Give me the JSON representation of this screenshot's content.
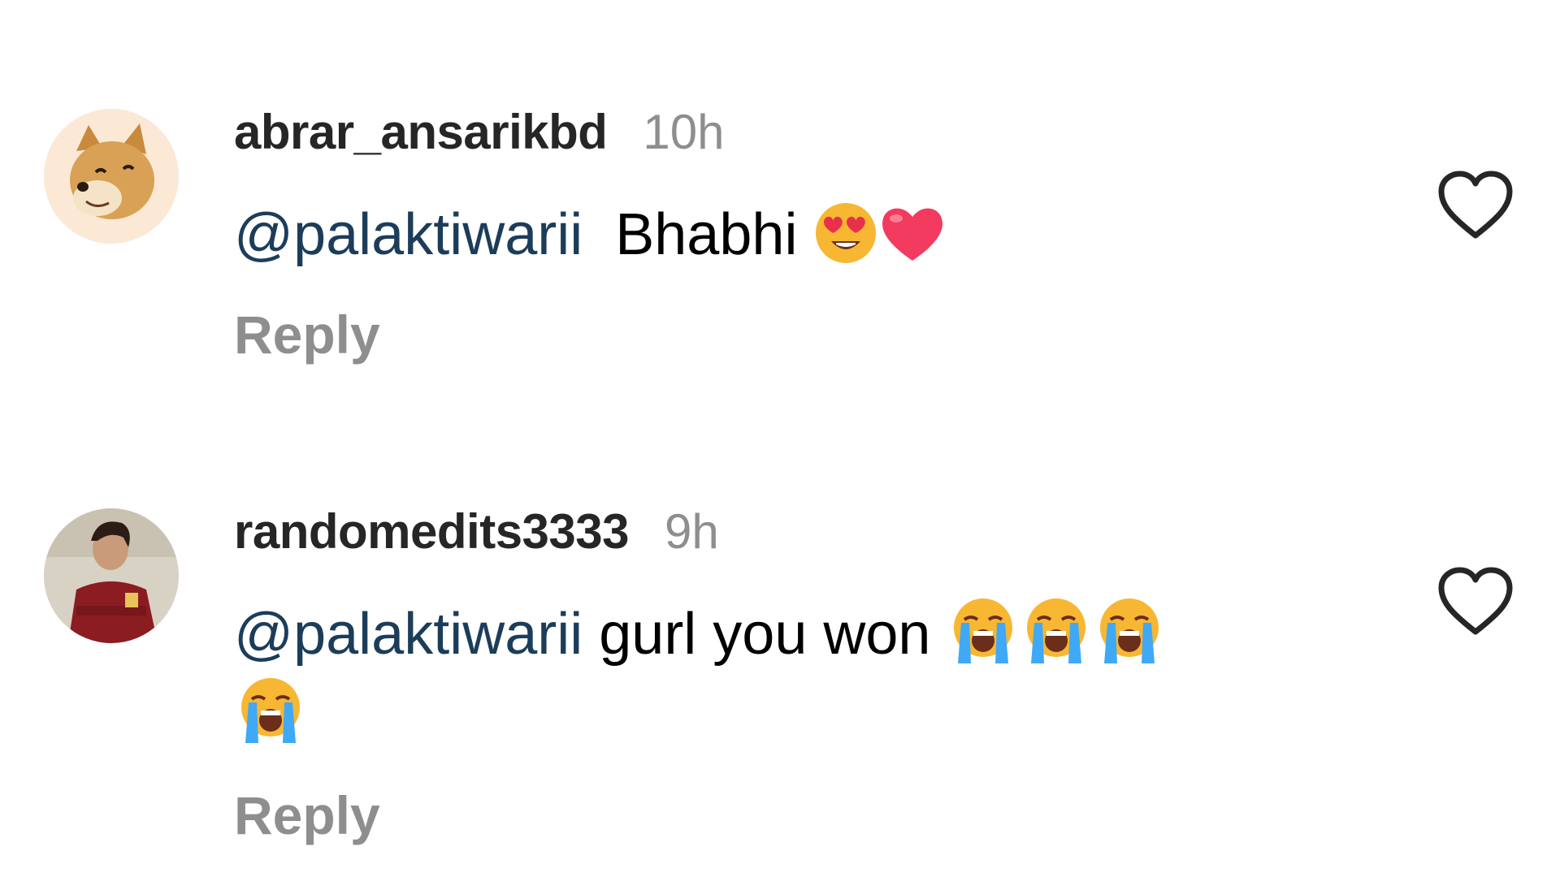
{
  "comments": [
    {
      "username": "abrar_ansarikbd",
      "time": "10h",
      "mention": "@palaktiwarii",
      "text": "  Bhabhi ",
      "emojis": [
        "heart-eyes",
        "red-heart"
      ],
      "reply_label": "Reply",
      "avatar": "doge-avatar"
    },
    {
      "username": "randomedits3333",
      "time": "9h",
      "mention": "@palaktiwarii",
      "text": " gurl you won ",
      "emojis": [
        "loudly-crying",
        "loudly-crying",
        "loudly-crying",
        "loudly-crying"
      ],
      "reply_label": "Reply",
      "avatar": "person-avatar"
    }
  ],
  "colors": {
    "username": "#262626",
    "meta": "#8e8e8e",
    "mention": "#1c3d5a",
    "heart_outline": "#262626"
  },
  "icons": {
    "like": "heart-outline-icon"
  }
}
